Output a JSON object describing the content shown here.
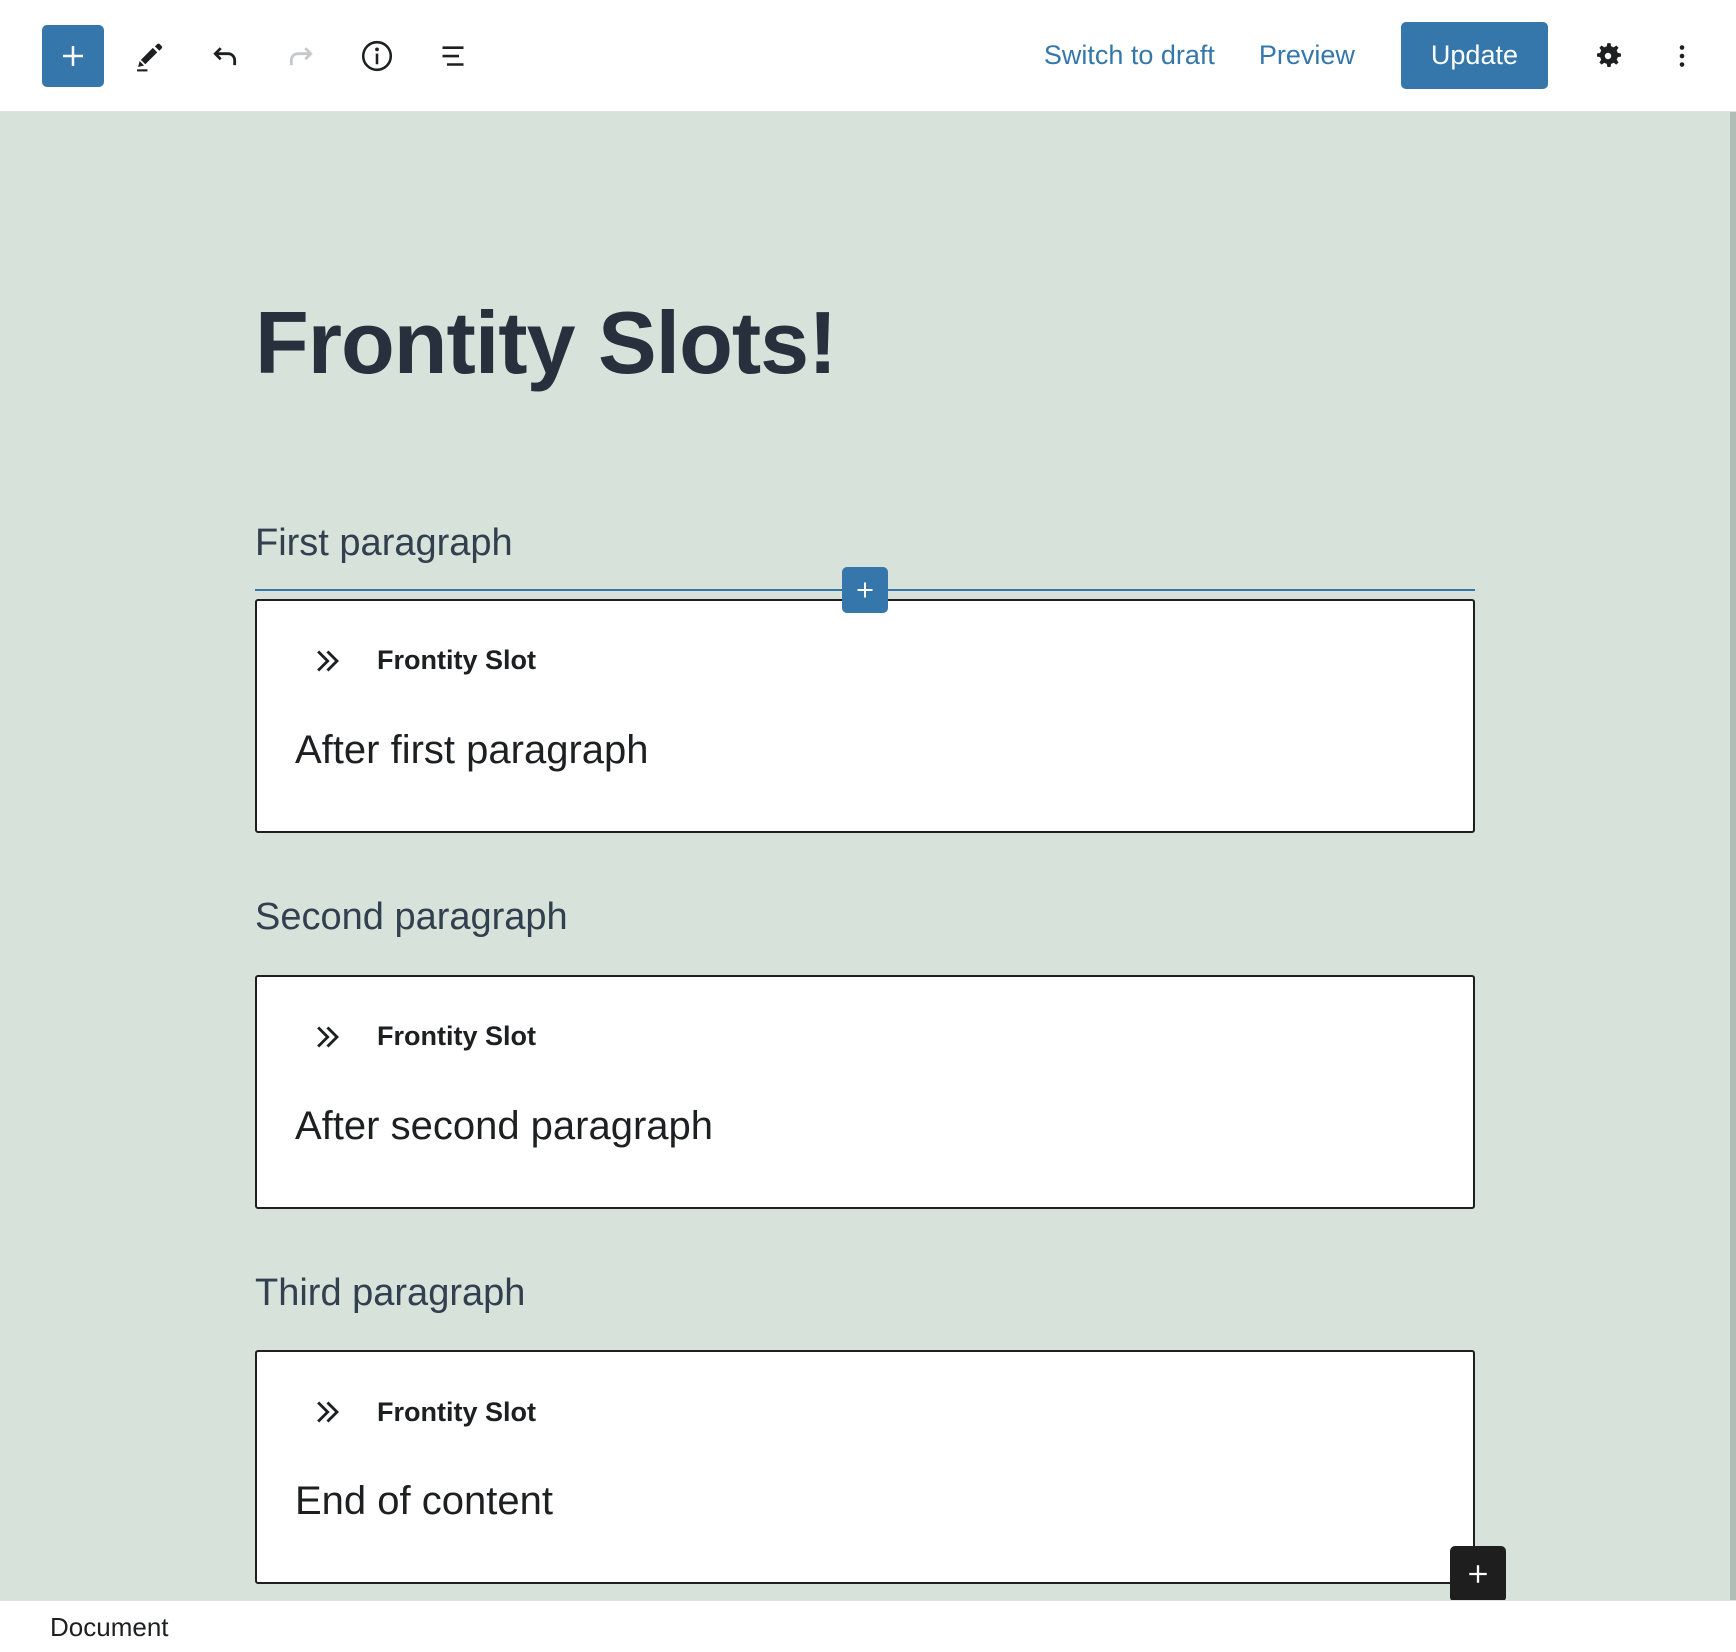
{
  "header": {
    "add_block": {
      "icon": "plus-icon",
      "label": "Add block"
    },
    "tools": [
      {
        "name": "edit-tools-icon",
        "label": "Tools",
        "disabled": false
      },
      {
        "name": "undo-icon",
        "label": "Undo",
        "disabled": false
      },
      {
        "name": "redo-icon",
        "label": "Redo",
        "disabled": true
      },
      {
        "name": "info-icon",
        "label": "Details",
        "disabled": false
      },
      {
        "name": "list-view-icon",
        "label": "List view",
        "disabled": false
      }
    ],
    "switch_to_draft": "Switch to draft",
    "preview": "Preview",
    "update": "Update",
    "settings_icon": "gear-icon",
    "options_icon": "kebab-menu-icon",
    "accent_color": "#3577ab"
  },
  "editor": {
    "canvas_background": "#d6e2da",
    "post_title": "Frontity Slots!",
    "inserter": {
      "icon": "plus-icon",
      "label": "Add block"
    },
    "appender": {
      "icon": "plus-icon",
      "label": "Add block"
    },
    "sections": [
      {
        "label": "First paragraph",
        "has_inserter": true,
        "block": {
          "icon": "double-chevron-right-icon",
          "title": "Frontity Slot",
          "body": "After first paragraph"
        }
      },
      {
        "label": "Second paragraph",
        "has_inserter": false,
        "block": {
          "icon": "double-chevron-right-icon",
          "title": "Frontity Slot",
          "body": "After second paragraph"
        }
      },
      {
        "label": "Third paragraph",
        "has_inserter": false,
        "block": {
          "icon": "double-chevron-right-icon",
          "title": "Frontity Slot",
          "body": "End of content"
        }
      }
    ]
  },
  "footer": {
    "breadcrumb": "Document"
  }
}
